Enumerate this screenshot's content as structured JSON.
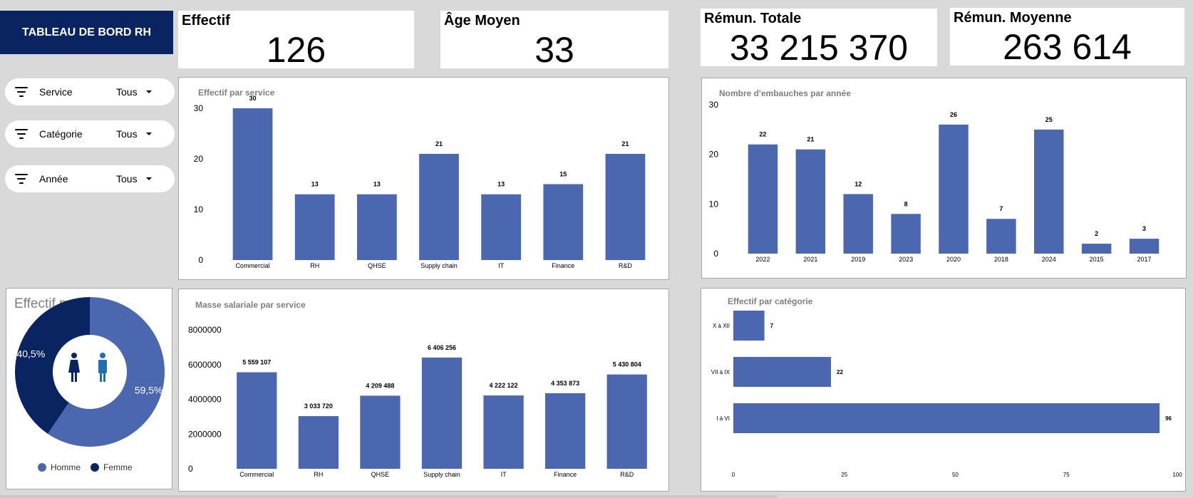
{
  "header": {
    "title": "TABLEAU DE BORD RH"
  },
  "kpis": {
    "effectif": {
      "label": "Effectif",
      "value": "126"
    },
    "age": {
      "label": "Âge Moyen",
      "value": "33"
    },
    "remun_totale": {
      "label": "Rémun. Totale",
      "value": "33 215 370"
    },
    "remun_moyenne": {
      "label": "Rémun. Moyenne",
      "value": "263 614"
    }
  },
  "filters": [
    {
      "label": "Service",
      "value": "Tous"
    },
    {
      "label": "Catégorie",
      "value": "Tous"
    },
    {
      "label": "Année",
      "value": "Tous"
    }
  ],
  "colors": {
    "bar": "#4a67b0",
    "header_bg": "#0a2361",
    "homme": "#4a67b0",
    "femme": "#0a2361"
  },
  "chart_data": [
    {
      "id": "effectif_service",
      "type": "bar",
      "title": "Effectif par service",
      "categories": [
        "Commercial",
        "RH",
        "QHSE",
        "Supply chain",
        "IT",
        "Finance",
        "R&D"
      ],
      "values": [
        30,
        13,
        13,
        21,
        13,
        15,
        21
      ],
      "value_labels": [
        "30",
        "13",
        "13",
        "21",
        "13",
        "15",
        "21"
      ],
      "yticks": [
        "0",
        "10",
        "20",
        "30"
      ],
      "ylim": [
        0,
        30
      ]
    },
    {
      "id": "embauches_annee",
      "type": "bar",
      "title": "Nombre d'embauches par année",
      "categories": [
        "2022",
        "2021",
        "2019",
        "2023",
        "2020",
        "2018",
        "2024",
        "2015",
        "2017"
      ],
      "values": [
        22,
        21,
        12,
        8,
        26,
        7,
        25,
        2,
        3
      ],
      "value_labels": [
        "22",
        "21",
        "12",
        "8",
        "26",
        "7",
        "25",
        "2",
        "3"
      ],
      "yticks": [
        "0",
        "10",
        "20",
        "30"
      ],
      "ylim": [
        0,
        30
      ]
    },
    {
      "id": "masse_salariale",
      "type": "bar",
      "title": "Masse salariale par service",
      "categories": [
        "Commercial",
        "RH",
        "QHSE",
        "Supply chain",
        "IT",
        "Finance",
        "R&D"
      ],
      "values": [
        5559107,
        3033720,
        4209488,
        6406256,
        4222122,
        4353873,
        5430804
      ],
      "value_labels": [
        "5 559 107",
        "3 033 720",
        "4 209 488",
        "6 406 256",
        "4 222 122",
        "4 353 873",
        "5 430 804"
      ],
      "yticks": [
        "0",
        "2000000",
        "4000000",
        "6000000",
        "8000000"
      ],
      "ylim": [
        0,
        8000000
      ]
    },
    {
      "id": "effectif_categorie",
      "type": "bar",
      "orientation": "horizontal",
      "title": "Effectif par catégorie",
      "categories": [
        "X à XII",
        "VII à IX",
        "I à VI"
      ],
      "values": [
        7,
        22,
        96
      ],
      "value_labels": [
        "7",
        "22",
        "96"
      ],
      "xticks": [
        "0",
        "25",
        "50",
        "75",
        "100"
      ],
      "xlim": [
        0,
        100
      ]
    },
    {
      "id": "effectif_sexe",
      "type": "pie",
      "title": "Effectif par sexe",
      "slices": [
        {
          "name": "Homme",
          "value": 59.5,
          "label": "59,5%"
        },
        {
          "name": "Femme",
          "value": 40.5,
          "label": "40,5%"
        }
      ]
    }
  ]
}
